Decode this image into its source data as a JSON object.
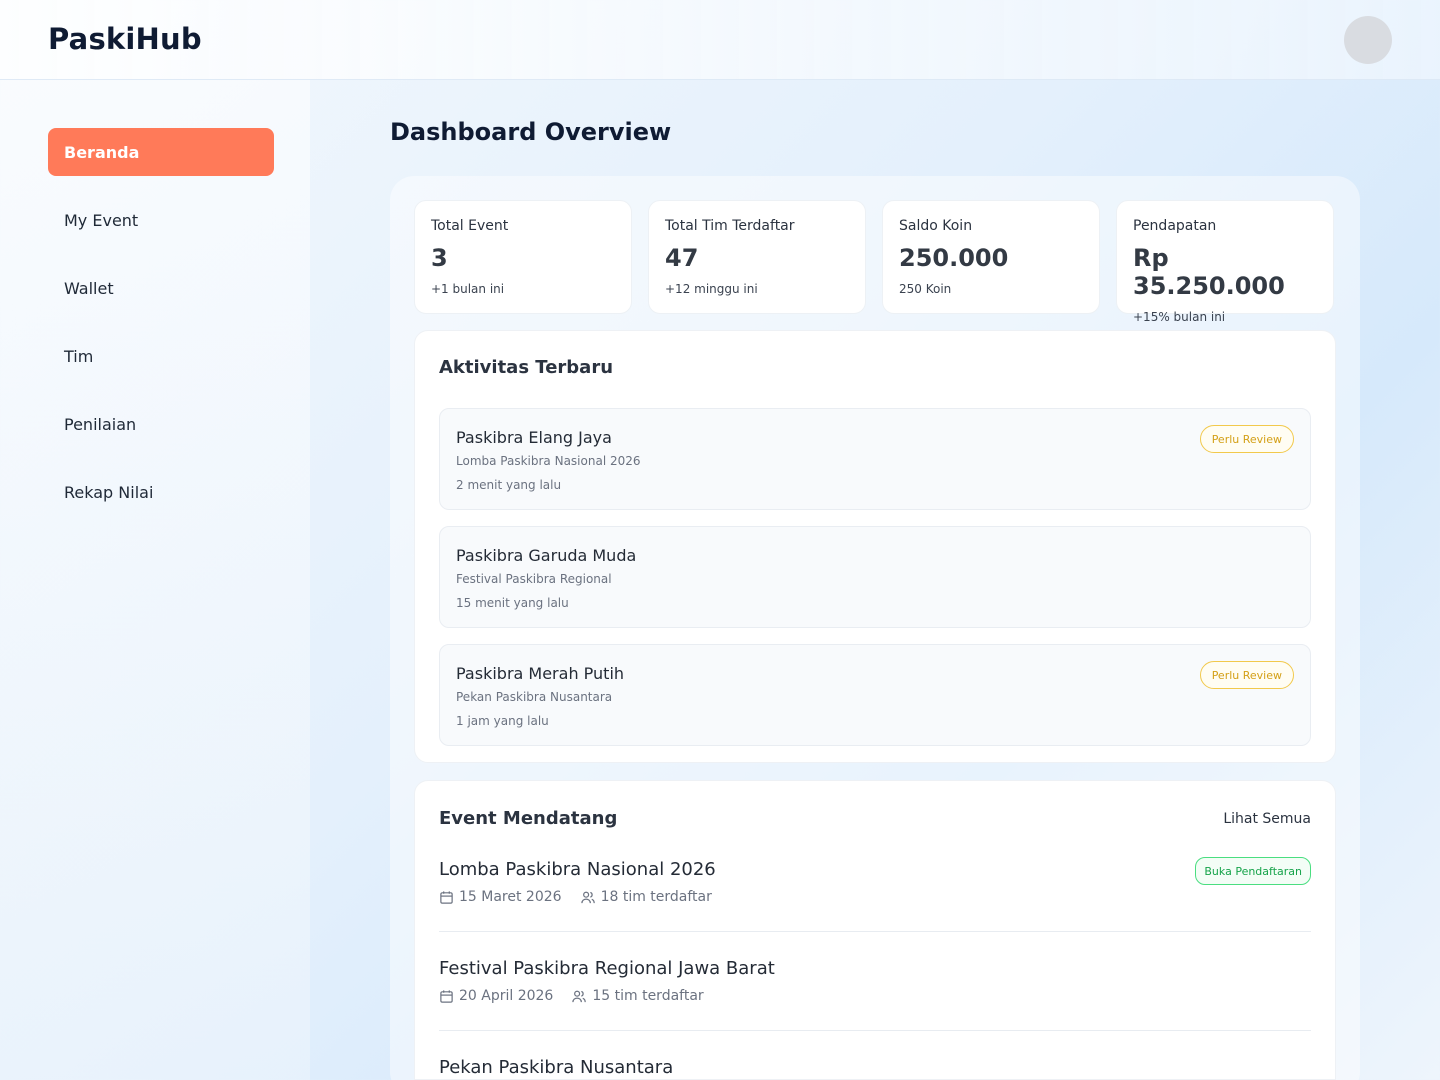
{
  "app": {
    "title": "PaskiHub"
  },
  "sidebar": {
    "items": [
      {
        "label": "Beranda",
        "active": true
      },
      {
        "label": "My Event"
      },
      {
        "label": "Wallet"
      },
      {
        "label": "Tim"
      },
      {
        "label": "Penilaian"
      },
      {
        "label": "Rekap Nilai"
      }
    ]
  },
  "page": {
    "title": "Dashboard Overview"
  },
  "stats": [
    {
      "label": "Total Event",
      "value": "3",
      "note": "+1 bulan ini"
    },
    {
      "label": "Total Tim Terdaftar",
      "value": "47",
      "note": "+12 minggu ini"
    },
    {
      "label": "Saldo Koin",
      "value": "250.000",
      "note": "250 Koin"
    },
    {
      "label": "Pendapatan",
      "value": "Rp 35.250.000",
      "note": "+15% bulan ini"
    }
  ],
  "activity": {
    "title": "Aktivitas Terbaru",
    "items": [
      {
        "name": "Paskibra Elang Jaya",
        "event": "Lomba Paskibra Nasional 2026",
        "time": "2 menit yang lalu",
        "badge": "Perlu Review"
      },
      {
        "name": "Paskibra Garuda Muda",
        "event": "Festival Paskibra Regional",
        "time": "15 menit yang lalu"
      },
      {
        "name": "Paskibra Merah Putih",
        "event": "Pekan Paskibra Nusantara",
        "time": "1 jam yang lalu",
        "badge": "Perlu Review"
      }
    ]
  },
  "events": {
    "title": "Event Mendatang",
    "see_all": "Lihat Semua",
    "items": [
      {
        "name": "Lomba Paskibra Nasional 2026",
        "date": "15 Maret 2026",
        "teams": "18 tim terdaftar",
        "badge": "Buka Pendaftaran"
      },
      {
        "name": "Festival Paskibra Regional Jawa Barat",
        "date": "20 April 2026",
        "teams": "15 tim terdaftar"
      },
      {
        "name": "Pekan Paskibra Nusantara"
      }
    ]
  },
  "colors": {
    "accent": "#ff7a59",
    "review_badge": "#f2c94c",
    "open_badge": "#22c55e"
  },
  "icons": {
    "date": "calendar-icon",
    "teams": "users-icon"
  }
}
